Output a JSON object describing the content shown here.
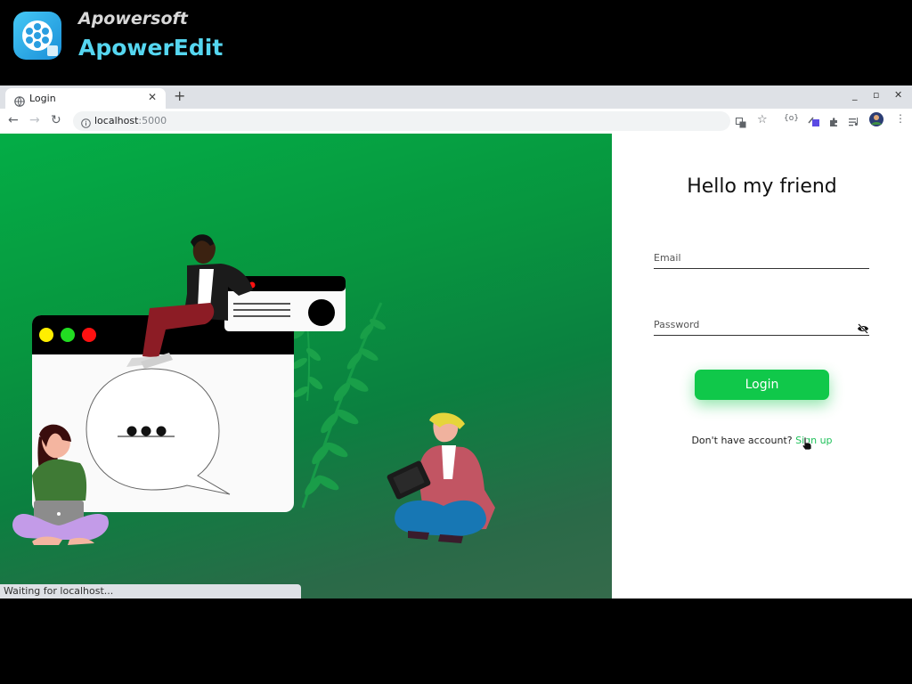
{
  "branding": {
    "maker": "Apowersoft",
    "app_name": "ApowerEdit",
    "logo_icon": "film-reel-icon"
  },
  "browser": {
    "tab": {
      "title": "Login",
      "favicon": "globe-icon"
    },
    "new_tab_symbol": "+",
    "window_controls": [
      "_",
      "▫",
      "✕"
    ],
    "url": {
      "host": "localhost",
      "port": ":5000"
    },
    "status_text": "Waiting for localhost..."
  },
  "login": {
    "greeting": "Hello my friend",
    "email_placeholder": "Email",
    "password_placeholder": "Password",
    "button_label": "Login",
    "signup_prompt": "Don't have account?",
    "signup_link": "Sign up"
  },
  "colors": {
    "brand_accent": "#55d6f0",
    "primary_green": "#10c84a",
    "hero_green": "#07963f"
  }
}
